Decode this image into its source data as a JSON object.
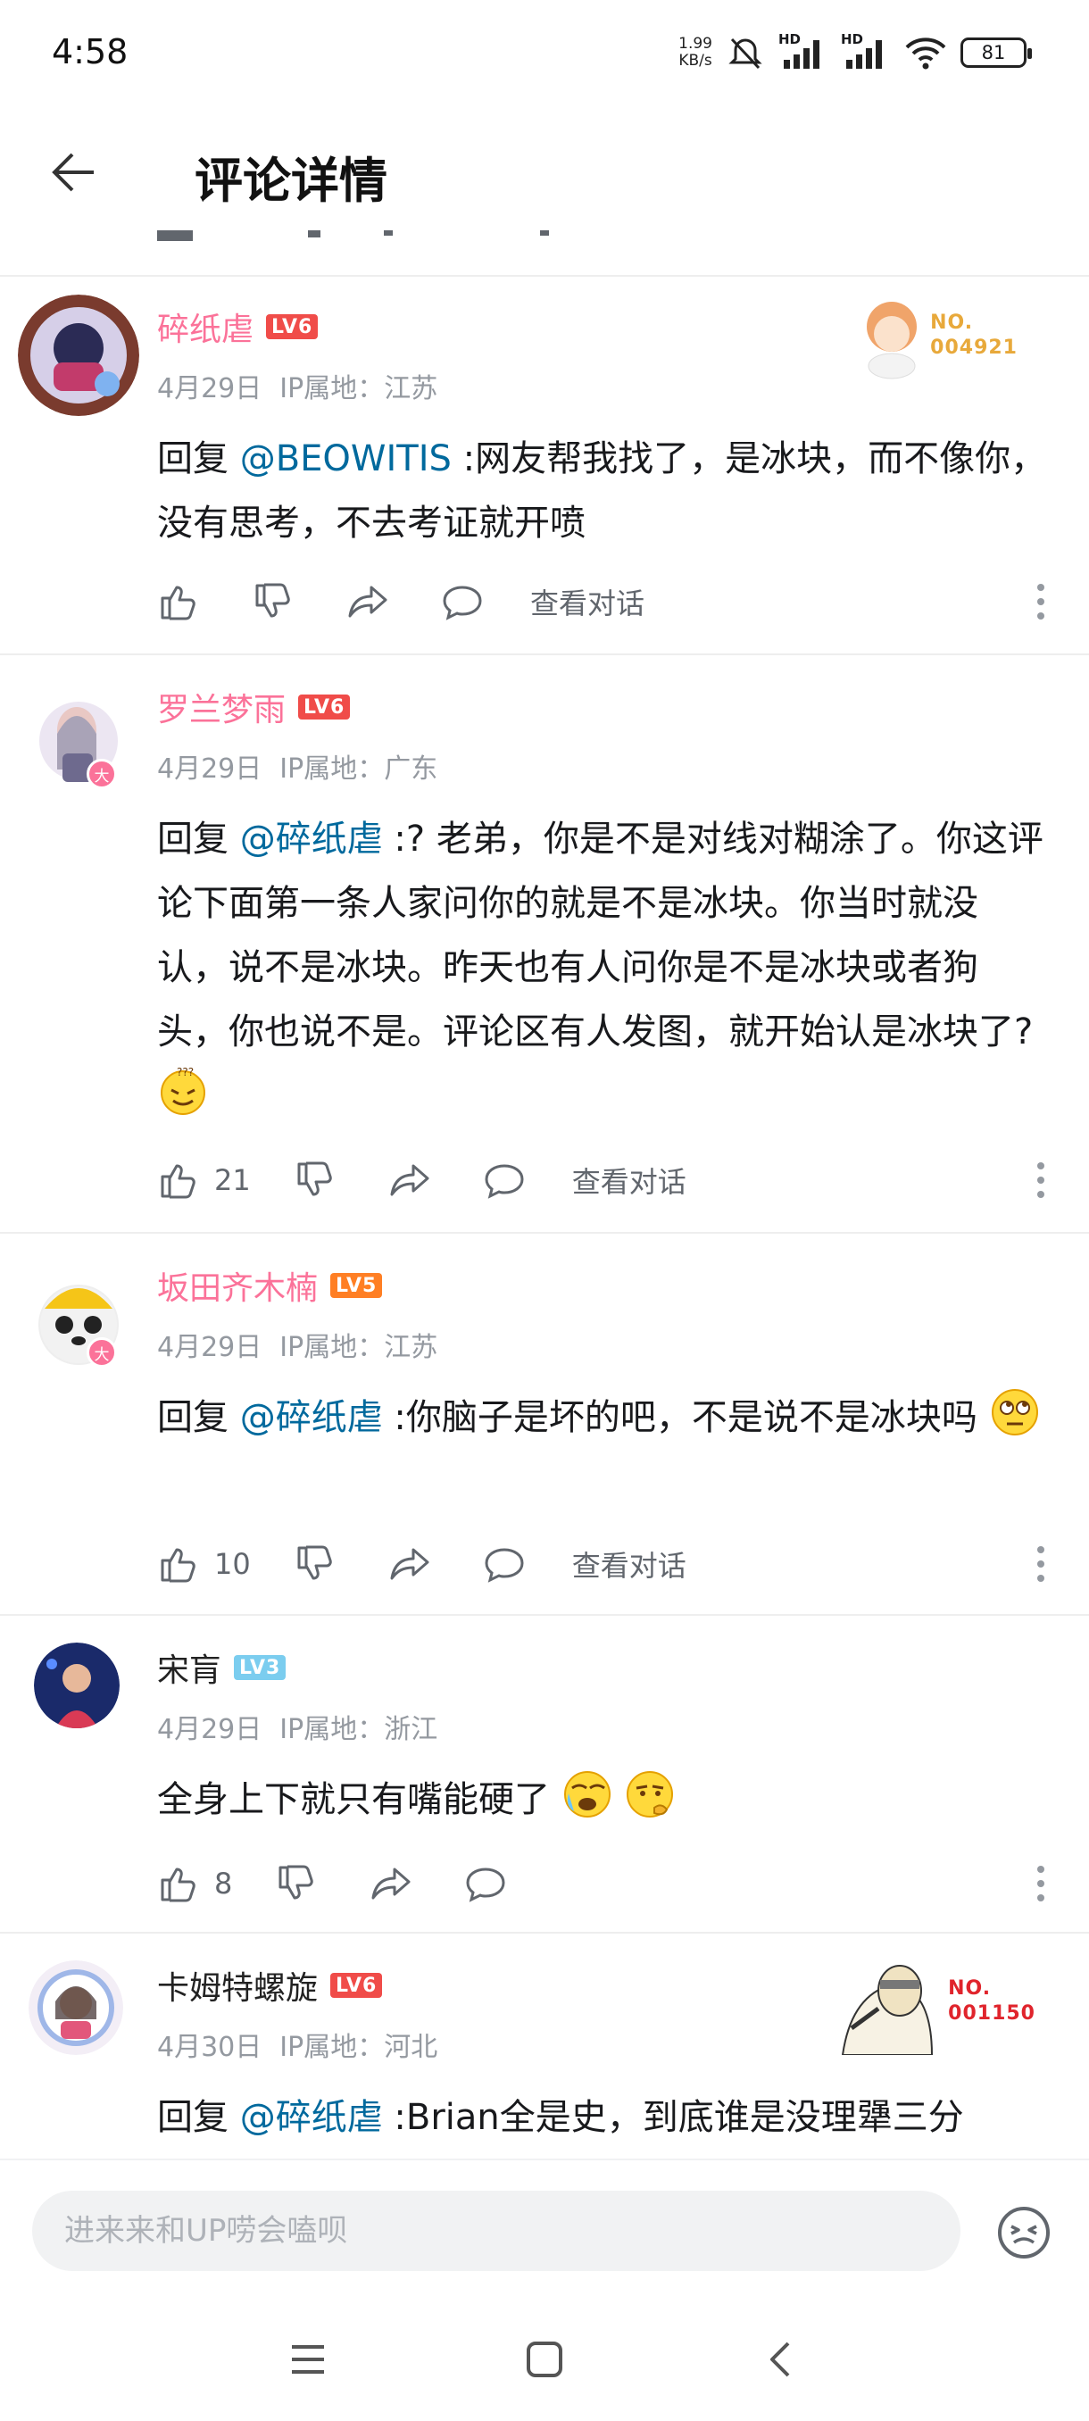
{
  "status_bar": {
    "time": "4:58",
    "net_speed_value": "1.99",
    "net_speed_unit": "KB/s",
    "hd1": "HD",
    "hd2": "HD",
    "battery": "81"
  },
  "header": {
    "title": "评论详情"
  },
  "comments": [
    {
      "username": "碎纸虐",
      "level": "LV6",
      "date": "4月29日",
      "ip": "IP属地：江苏",
      "reply_prefix": "回复 ",
      "mention": "@BEOWITIS",
      "text": " :网友帮我找了，是冰块，而不像你，没有思考，不去考证就开喷",
      "likes": "",
      "view_conversation": "查看对话",
      "badge_no": "NO.",
      "badge_number": "004921"
    },
    {
      "username": "罗兰梦雨",
      "level": "LV6",
      "date": "4月29日",
      "ip": "IP属地：广东",
      "reply_prefix": "回复 ",
      "mention": "@碎纸虐",
      "text": " :? 老弟，你是不是对线对糊涂了。你这评论下面第一条人家问你的就是不是冰块。你当时就没认，说不是冰块。昨天也有人问你是不是冰块或者狗头，你也说不是。评论区有人发图，就开始认是冰块了?",
      "likes": "21",
      "view_conversation": "查看对话",
      "avatar_badge": "大"
    },
    {
      "username": "坂田齐木楠",
      "level": "LV5",
      "date": "4月29日",
      "ip": "IP属地：江苏",
      "reply_prefix": "回复 ",
      "mention": "@碎纸虐",
      "text": " :你脑子是坏的吧，不是说不是冰块吗",
      "likes": "10",
      "view_conversation": "查看对话",
      "avatar_badge": "大"
    },
    {
      "username": "宋肓",
      "level": "LV3",
      "date": "4月29日",
      "ip": "IP属地：浙江",
      "text": "全身上下就只有嘴能硬了",
      "likes": "8"
    },
    {
      "username": "卡姆特螺旋",
      "level": "LV6",
      "date": "4月30日",
      "ip": "IP属地：河北",
      "reply_prefix": "回复 ",
      "mention": "@碎纸虐",
      "text": " :Brian全是史，到底谁是没理犟三分",
      "badge_no": "NO.",
      "badge_number": "001150"
    }
  ],
  "bottom": {
    "reply_placeholder": "进来来和UP唠会嗑呗"
  },
  "colors": {
    "pink_name": "#fb7299",
    "mention_blue": "#00699d",
    "lv6": "#f04c49",
    "lv5": "#ff7f24",
    "lv3": "#7bcdef",
    "meta_gray": "#9499a0",
    "badge_gold": "#e8a93b",
    "badge_red": "#e0242c"
  }
}
